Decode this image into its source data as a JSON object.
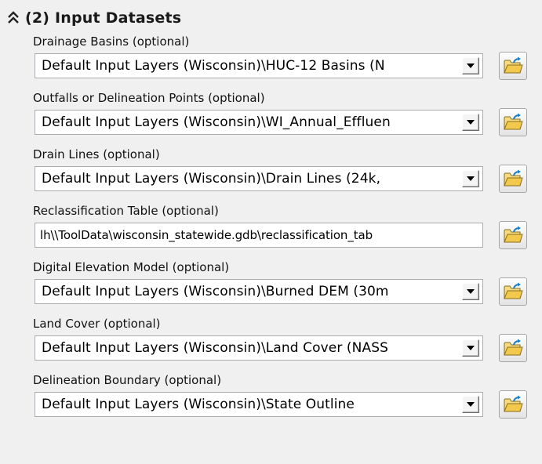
{
  "section": {
    "collapse_icon": "double-chevron-up-icon",
    "title": "(2) Input Datasets"
  },
  "params": [
    {
      "label": "Drainage Basins (optional)",
      "type": "combo",
      "value": "Default Input Layers (Wisconsin)\\HUC-12 Basins (N"
    },
    {
      "label": "Outfalls or Delineation Points (optional)",
      "type": "combo",
      "value": "Default Input Layers (Wisconsin)\\WI_Annual_Effluen"
    },
    {
      "label": "Drain Lines (optional)",
      "type": "combo",
      "value": "Default Input Layers (Wisconsin)\\Drain Lines (24k,"
    },
    {
      "label": "Reclassification Table (optional)",
      "type": "text",
      "value": "lh\\\\ToolData\\wisconsin_statewide.gdb\\reclassification_tab"
    },
    {
      "label": "Digital Elevation Model (optional)",
      "type": "combo",
      "value": "Default Input Layers (Wisconsin)\\Burned DEM (30m"
    },
    {
      "label": "Land Cover (optional)",
      "type": "combo",
      "value": "Default Input Layers (Wisconsin)\\Land Cover (NASS"
    },
    {
      "label": "Delineation Boundary (optional)",
      "type": "combo",
      "value": "Default Input Layers (Wisconsin)\\State Outline"
    }
  ],
  "icons": {
    "dropdown": "dropdown-arrow-icon",
    "browse": "open-folder-icon"
  },
  "colors": {
    "background": "#f0f0f0",
    "input_border": "#abadb3",
    "folder_yellow": "#f2c94c",
    "folder_arrow": "#1e7fc6"
  }
}
